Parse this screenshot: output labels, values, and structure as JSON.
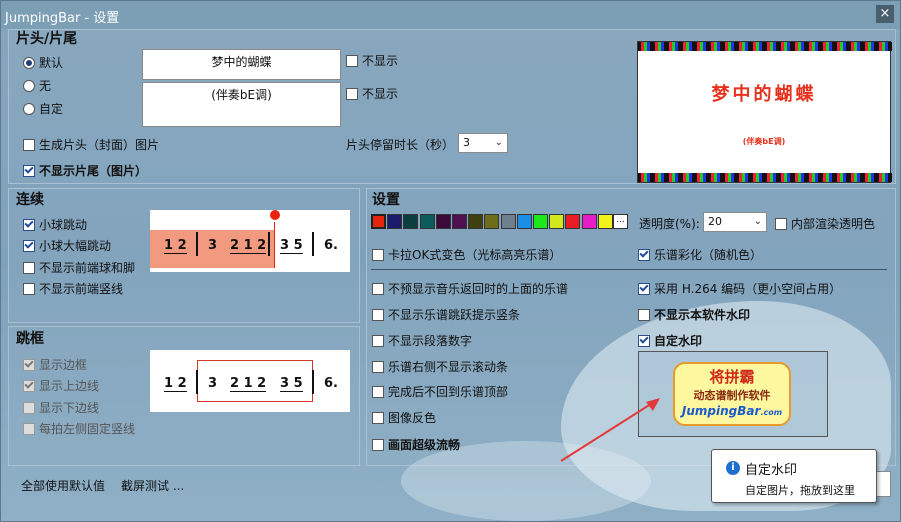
{
  "window": {
    "title": "JumpingBar - 设置",
    "close_glyph": "×"
  },
  "intro_outro": {
    "title": "片头/片尾",
    "radios": [
      {
        "label": "默认",
        "checked": true
      },
      {
        "label": "无",
        "checked": false
      },
      {
        "label": "自定",
        "checked": false
      }
    ],
    "song_title": "梦中的蝴蝶",
    "subtitle": "(伴奏bE调)",
    "hide_title_label": "不显示",
    "hide_subtitle_label": "不显示",
    "gen_cover_label": "生成片头（封面）图片",
    "hide_outro_label": "不显示片尾（图片）",
    "duration_label": "片头停留时长（秒）",
    "duration_value": "3",
    "preview_title": "梦中的蝴蝶",
    "preview_subtitle": "(伴奏bE调)"
  },
  "continuous": {
    "title": "连续",
    "options": [
      {
        "label": "小球跳动",
        "checked": true
      },
      {
        "label": "小球大幅跳动",
        "checked": true
      },
      {
        "label": "不显示前端球和脚",
        "checked": false
      },
      {
        "label": "不显示前端竖线",
        "checked": false
      }
    ]
  },
  "jump_frame": {
    "title": "跳框",
    "options": [
      {
        "label": "显示边框",
        "checked": true
      },
      {
        "label": "显示上边线",
        "checked": true
      },
      {
        "label": "显示下边线",
        "checked": false
      },
      {
        "label": "每拍左侧固定竖线",
        "checked": false
      }
    ]
  },
  "music": {
    "n1": "1 2",
    "n2": "3",
    "n3": "2 1 2",
    "n4": "3 5",
    "n5": "6."
  },
  "settings": {
    "title": "设置",
    "colors": [
      "#e8240f",
      "#1b1b6b",
      "#0b3f3f",
      "#0b5c5c",
      "#3a0b3a",
      "#4e1051",
      "#3f3f10",
      "#6e6e1a",
      "#6e7f8e",
      "#1c8ee6",
      "#1de81c",
      "#d3e81c",
      "#e81c25",
      "#e81cc9",
      "#f2f21c"
    ],
    "more_label": "...",
    "opacity_label": "透明度(%):",
    "opacity_value": "20",
    "inner_transparent_label": "内部渲染透明色",
    "karaoke_label": "卡拉OK式变色（光标高亮乐谱）",
    "rainbow_label": "乐谱彩化（随机色）",
    "left_options": [
      {
        "label": "不预显示音乐返回时的上面的乐谱",
        "checked": false,
        "bold": false
      },
      {
        "label": "不显示乐谱跳跃提示竖条",
        "checked": false,
        "bold": false
      },
      {
        "label": "不显示段落数字",
        "checked": false,
        "bold": false
      },
      {
        "label": "乐谱右侧不显示滚动条",
        "checked": false,
        "bold": false
      },
      {
        "label": "完成后不回到乐谱顶部",
        "checked": false,
        "bold": false
      },
      {
        "label": "图像反色",
        "checked": false,
        "bold": false
      },
      {
        "label": "画面超级流畅",
        "checked": false,
        "bold": true
      }
    ],
    "h264_label": "采用 H.264 编码（更小空间占用）",
    "no_watermark_label": "不显示本软件水印",
    "custom_watermark_label": "自定水印"
  },
  "watermark": {
    "line1": "将拼霸",
    "line2": "动态谱制作软件",
    "line3": "JumpingBar",
    "line3_suffix": ".com"
  },
  "tooltip": {
    "title": "自定水印",
    "body": "自定图片，拖放到这里",
    "info_glyph": "i"
  },
  "footer": {
    "defaults_label": "全部使用默认值",
    "screen_test_label": "截屏测试 ..."
  }
}
